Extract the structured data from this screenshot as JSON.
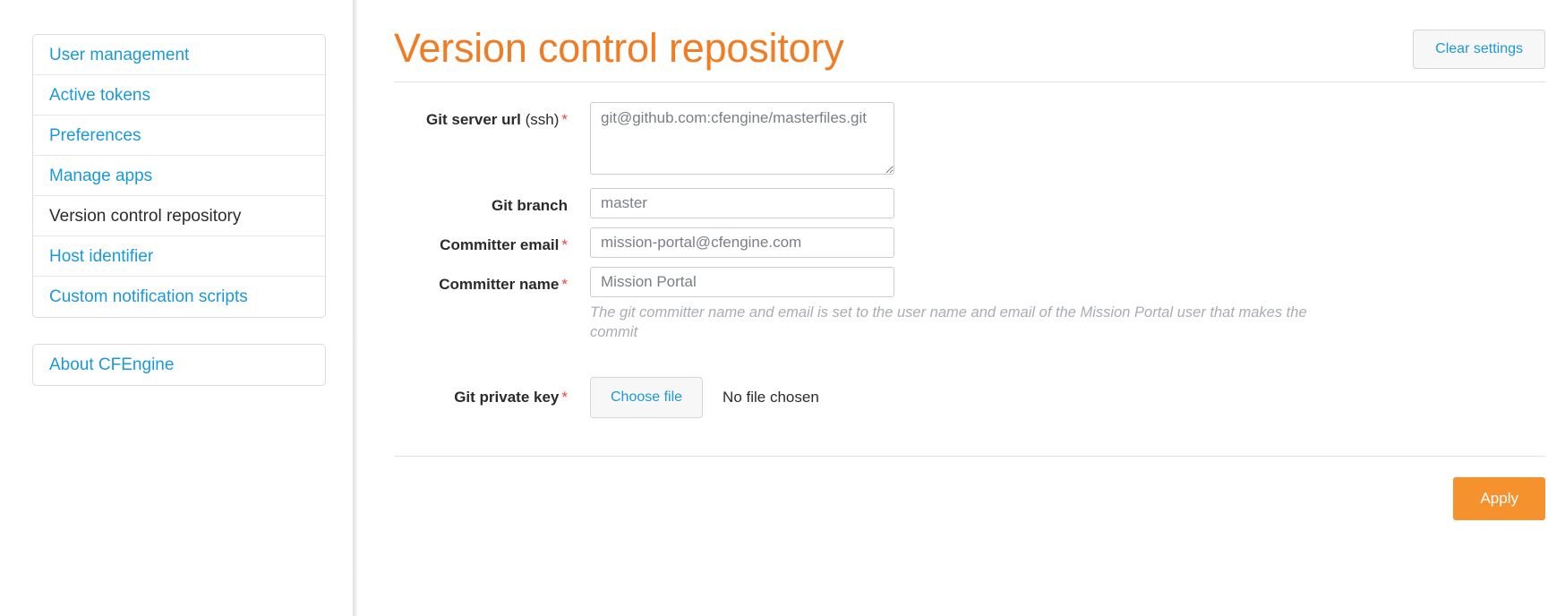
{
  "sidebar": {
    "primary_nav": [
      {
        "label": "User management",
        "active": false
      },
      {
        "label": "Active tokens",
        "active": false
      },
      {
        "label": "Preferences",
        "active": false
      },
      {
        "label": "Manage apps",
        "active": false
      },
      {
        "label": "Version control repository",
        "active": true
      },
      {
        "label": "Host identifier",
        "active": false
      },
      {
        "label": "Custom notification scripts",
        "active": false
      }
    ],
    "secondary_nav": [
      {
        "label": "About CFEngine",
        "active": false
      }
    ]
  },
  "header": {
    "title": "Version control repository",
    "clear_settings_label": "Clear settings"
  },
  "form": {
    "git_server_url": {
      "label": "Git server url",
      "label_sub": "(ssh)",
      "required_marker": "*",
      "value": "git@github.com:cfengine/masterfiles.git"
    },
    "git_branch": {
      "label": "Git branch",
      "required_marker": "",
      "value": "master"
    },
    "committer_email": {
      "label": "Committer email",
      "required_marker": "*",
      "value": "mission-portal@cfengine.com"
    },
    "committer_name": {
      "label": "Committer name",
      "required_marker": "*",
      "value": "Mission Portal"
    },
    "committer_help": "The git committer name and email is set to the user name and email of the Mission Portal user that makes the commit",
    "git_private_key": {
      "label": "Git private key",
      "required_marker": "*",
      "choose_file_label": "Choose file",
      "file_status": "No file chosen"
    }
  },
  "footer": {
    "apply_label": "Apply"
  },
  "colors": {
    "accent_orange": "#f07d24",
    "apply_orange": "#f6922d",
    "link_blue": "#1a9ad7",
    "required_red": "#e8453c",
    "help_gray": "#a9adb3"
  }
}
